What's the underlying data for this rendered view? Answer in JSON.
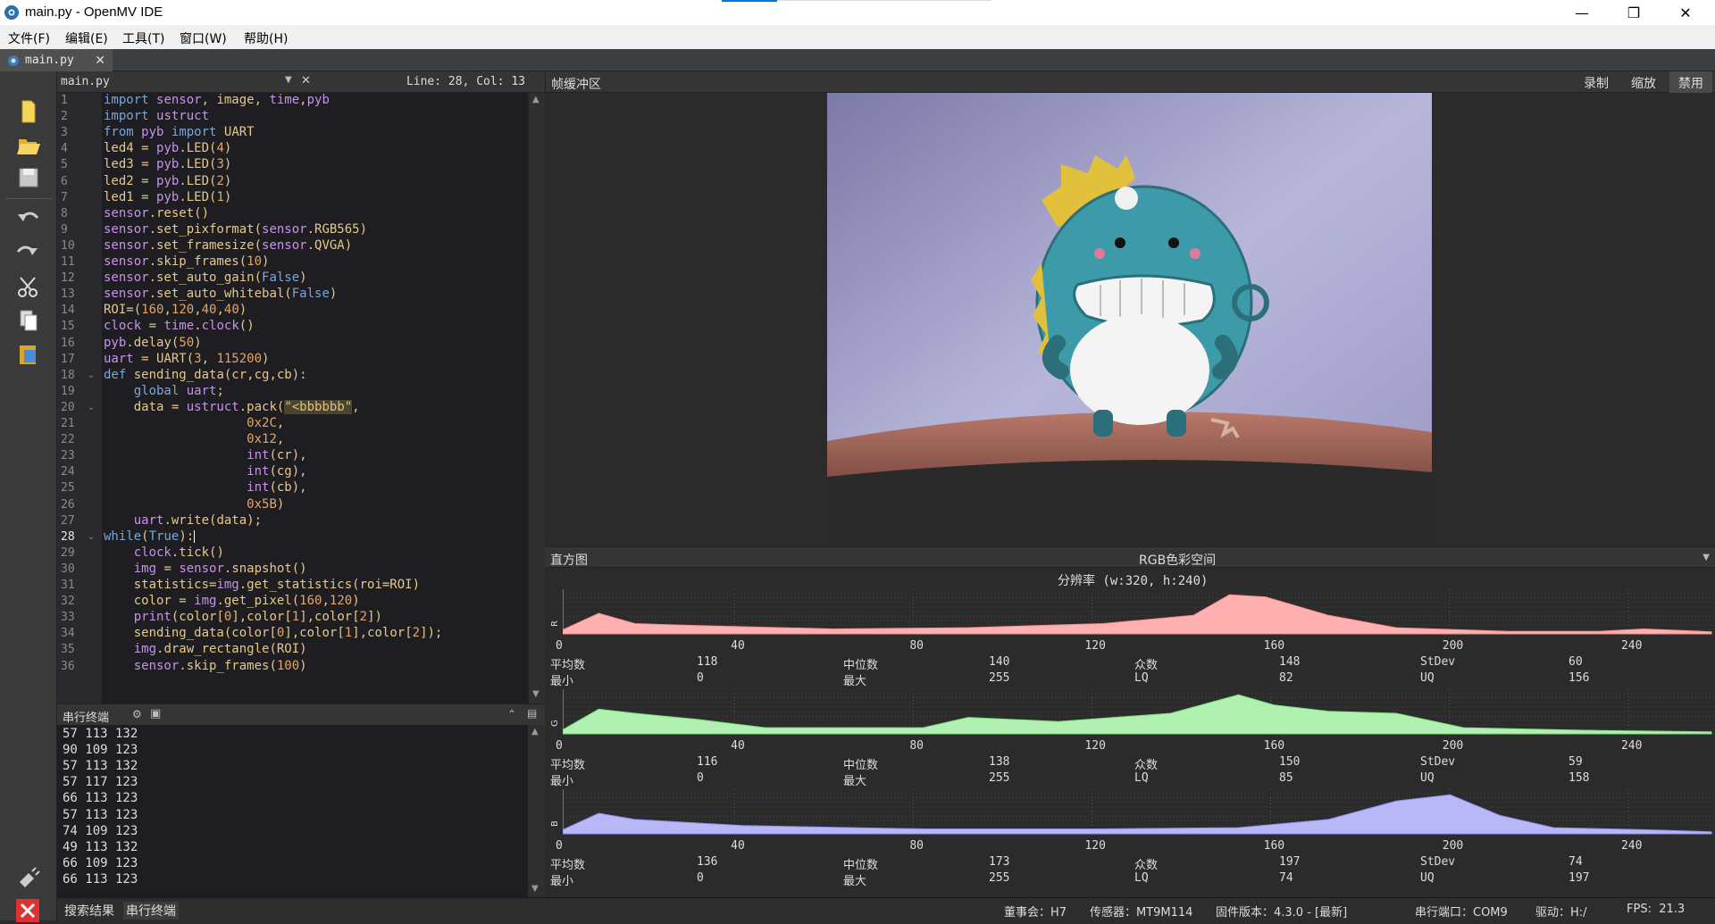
{
  "window": {
    "title": "main.py - OpenMV IDE"
  },
  "menu": [
    "文件(F)",
    "编辑(E)",
    "工具(T)",
    "窗口(W)",
    "帮助(H)"
  ],
  "file_tab": {
    "name": "main.py"
  },
  "editor": {
    "file_name": "main.py",
    "cursor": "Line: 28, Col: 13",
    "lines": [
      "import sensor, image, time,pyb",
      "import ustruct",
      "from pyb import UART",
      "led4 = pyb.LED(4)",
      "led3 = pyb.LED(3)",
      "led2 = pyb.LED(2)",
      "led1 = pyb.LED(1)",
      "sensor.reset()",
      "sensor.set_pixformat(sensor.RGB565)",
      "sensor.set_framesize(sensor.QVGA)",
      "sensor.skip_frames(10)",
      "sensor.set_auto_gain(False)",
      "sensor.set_auto_whitebal(False)",
      "ROI=(160,120,40,40)",
      "clock = time.clock()",
      "pyb.delay(50)",
      "uart = UART(3, 115200)",
      "def sending_data(cr,cg,cb):",
      "    global uart;",
      "    data = ustruct.pack(\"<bbbbbb\",",
      "                   0x2C,",
      "                   0x12,",
      "                   int(cr),",
      "                   int(cg),",
      "                   int(cb),",
      "                   0x5B)",
      "    uart.write(data);",
      "while(True):",
      "    clock.tick()",
      "    img = sensor.snapshot()",
      "    statistics=img.get_statistics(roi=ROI)",
      "    color = img.get_pixel(160,120)",
      "    print(color[0],color[1],color[2])",
      "    sending_data(color[0],color[1],color[2]);",
      "    img.draw_rectangle(ROI)",
      "    sensor.skip_frames(100)"
    ]
  },
  "terminal": {
    "title": "串行终端",
    "lines": [
      "57 113 132",
      "90 109 123",
      "57 113 132",
      "57 117 123",
      "66 113 123",
      "57 113 123",
      "74 109 123",
      "49 113 132",
      "66 109 123",
      "66 113 123"
    ]
  },
  "frame_buffer": {
    "title": "帧缓冲区",
    "buttons": [
      "录制",
      "缩放",
      "禁用"
    ]
  },
  "histogram": {
    "title": "直方图",
    "colorspace": "RGB色彩空间",
    "resolution": "分辨率 (w:320, h:240)",
    "ticks": [
      "0",
      "40",
      "80",
      "120",
      "160",
      "200",
      "240"
    ],
    "channels": [
      {
        "label": "R",
        "color": "#ffb0b0",
        "stroke": "#ff8c8c",
        "stats": {
          "平均数": "118",
          "中位数": "140",
          "众数": "148",
          "StDev": "60",
          "最小": "0",
          "最大": "255",
          "LQ": "82",
          "UQ": "156"
        },
        "curve": [
          [
            0,
            0.1
          ],
          [
            8,
            0.5
          ],
          [
            16,
            0.25
          ],
          [
            30,
            0.2
          ],
          [
            60,
            0.12
          ],
          [
            90,
            0.15
          ],
          [
            120,
            0.25
          ],
          [
            140,
            0.45
          ],
          [
            148,
            0.95
          ],
          [
            156,
            0.9
          ],
          [
            170,
            0.45
          ],
          [
            185,
            0.15
          ],
          [
            210,
            0.06
          ],
          [
            230,
            0.06
          ],
          [
            240,
            0.12
          ],
          [
            255,
            0.05
          ]
        ]
      },
      {
        "label": "G",
        "color": "#b0f0b0",
        "stroke": "#7ce07c",
        "stats": {
          "平均数": "116",
          "中位数": "138",
          "众数": "150",
          "StDev": "59",
          "最小": "0",
          "最大": "255",
          "LQ": "85",
          "UQ": "158"
        },
        "curve": [
          [
            0,
            0.1
          ],
          [
            8,
            0.6
          ],
          [
            16,
            0.5
          ],
          [
            30,
            0.35
          ],
          [
            45,
            0.15
          ],
          [
            80,
            0.15
          ],
          [
            90,
            0.4
          ],
          [
            110,
            0.3
          ],
          [
            135,
            0.5
          ],
          [
            150,
            0.95
          ],
          [
            158,
            0.7
          ],
          [
            170,
            0.55
          ],
          [
            185,
            0.5
          ],
          [
            200,
            0.15
          ],
          [
            230,
            0.08
          ],
          [
            255,
            0.05
          ]
        ]
      },
      {
        "label": "B",
        "color": "#b8b8f8",
        "stroke": "#9090f0",
        "stats": {
          "平均数": "136",
          "中位数": "173",
          "众数": "197",
          "StDev": "74",
          "最小": "0",
          "最大": "255",
          "LQ": "74",
          "UQ": "197"
        },
        "curve": [
          [
            0,
            0.1
          ],
          [
            8,
            0.5
          ],
          [
            16,
            0.35
          ],
          [
            40,
            0.2
          ],
          [
            80,
            0.12
          ],
          [
            120,
            0.12
          ],
          [
            150,
            0.15
          ],
          [
            170,
            0.35
          ],
          [
            185,
            0.8
          ],
          [
            197,
            0.95
          ],
          [
            208,
            0.45
          ],
          [
            220,
            0.15
          ],
          [
            240,
            0.1
          ],
          [
            255,
            0.05
          ]
        ]
      }
    ]
  },
  "bottom_tabs": [
    "搜索结果",
    "串行终端"
  ],
  "status": [
    "董事会：H7",
    "传感器：MT9M114",
    "固件版本：4.3.0 - [最新]",
    "串行端口：COM9",
    "驱动：H:/",
    "FPS:  21.3"
  ]
}
